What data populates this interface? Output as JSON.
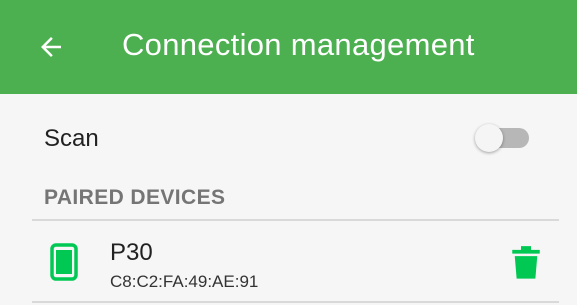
{
  "appbar": {
    "title": "Connection management",
    "back_icon": "arrow-left-icon",
    "color": "#4caf50"
  },
  "scan": {
    "label": "Scan",
    "enabled": false
  },
  "paired_section": {
    "header": "PAIRED DEVICES",
    "devices": [
      {
        "name": "P30",
        "mac": "C8:C2:FA:49:AE:91",
        "icon": "smartphone-icon",
        "action_icon": "trash-icon"
      }
    ]
  },
  "colors": {
    "accent": "#00c853",
    "header_text": "#757575"
  }
}
